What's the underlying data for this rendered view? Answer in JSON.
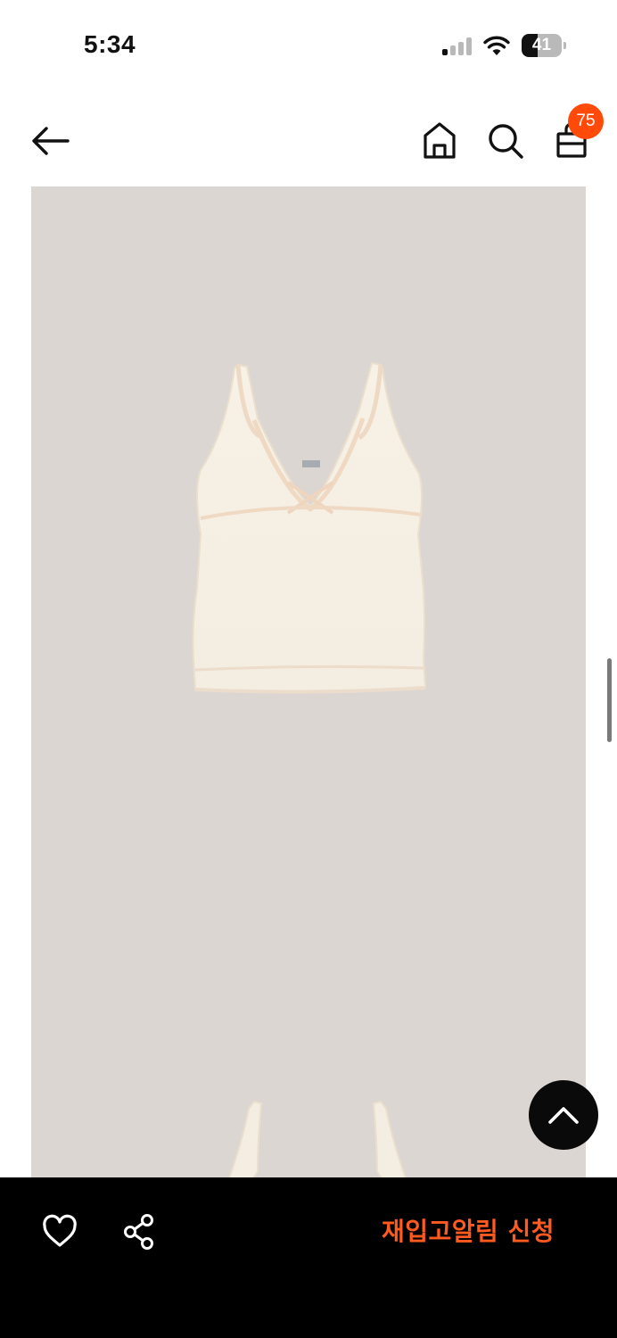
{
  "status_bar": {
    "time": "5:34",
    "battery_level": "41",
    "battery_fraction": 0.41
  },
  "nav": {
    "back_icon": "arrow-left-icon",
    "home_icon": "home-icon",
    "search_icon": "search-icon",
    "cart_icon": "shopping-bag-icon",
    "cart_count": "75"
  },
  "product": {
    "image_icon": "product-photo",
    "background_color": "#dcd6d3"
  },
  "scroll_top": {
    "icon": "chevron-up-icon"
  },
  "bottom_bar": {
    "like_icon": "heart-icon",
    "share_icon": "share-icon",
    "restock_label": "재입고알림 신청",
    "accent_color": "#ff5a1f"
  }
}
